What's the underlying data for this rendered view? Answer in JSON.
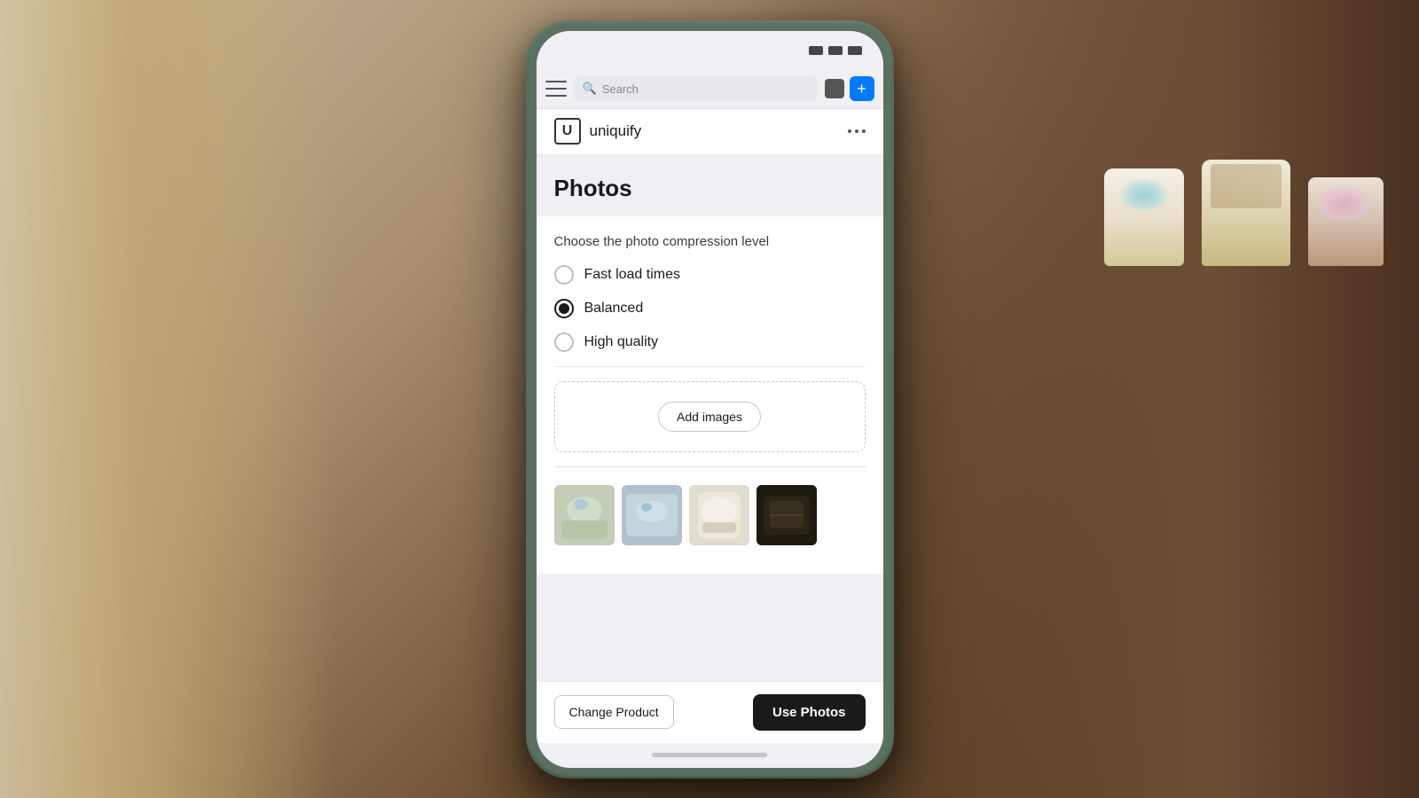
{
  "scene": {
    "bg_description": "Hands holding phone with soap bars in background"
  },
  "browser_bar": {
    "search_placeholder": "Search",
    "search_text": "Search"
  },
  "app": {
    "logo_symbol": "U",
    "name": "uniquify",
    "more_label": "..."
  },
  "page": {
    "title": "Photos",
    "compression_label": "Choose the photo compression level",
    "options": [
      {
        "id": "fast",
        "label": "Fast load times",
        "selected": false
      },
      {
        "id": "balanced",
        "label": "Balanced",
        "selected": true
      },
      {
        "id": "high",
        "label": "High quality",
        "selected": false
      }
    ]
  },
  "image_section": {
    "add_images_label": "Add images",
    "thumbnails": [
      {
        "id": 1,
        "alt": "Soap product 1"
      },
      {
        "id": 2,
        "alt": "Soap product 2"
      },
      {
        "id": 3,
        "alt": "Soap product 3"
      },
      {
        "id": 4,
        "alt": "Soap product 4"
      }
    ]
  },
  "bottom_bar": {
    "change_product_label": "Change Product",
    "use_photos_label": "Use Photos"
  }
}
